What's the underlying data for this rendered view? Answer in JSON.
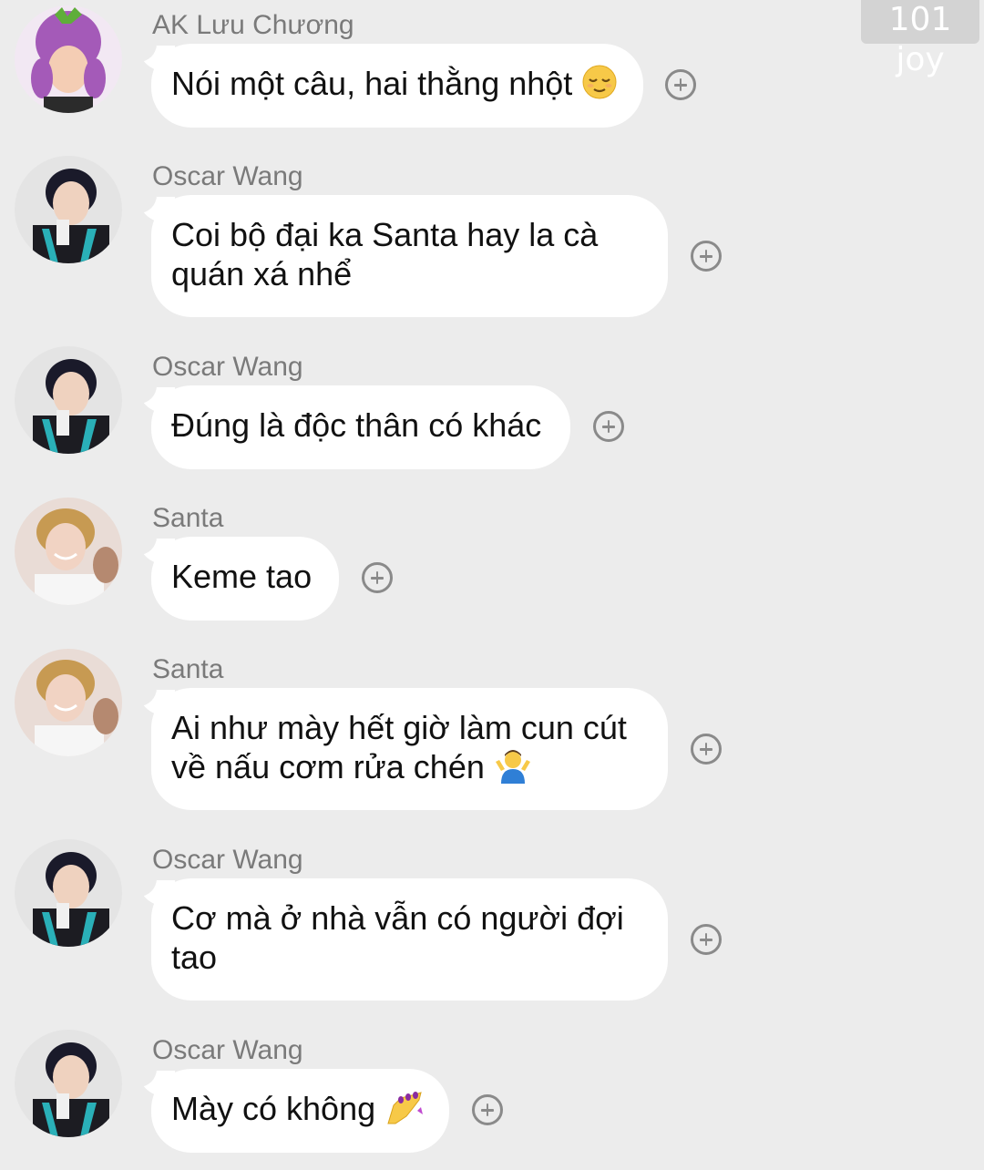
{
  "watermark": "101 joy",
  "messages": [
    {
      "sender": "AK Lưu Chương",
      "lines": [
        "Nói một câu, hai thằng nhột"
      ],
      "emoji": "relieved-face-emoji"
    },
    {
      "sender": "Oscar Wang",
      "lines": [
        "Coi bộ đại ka Santa hay la cà",
        "quán xá nhể"
      ],
      "emoji": null
    },
    {
      "sender": "Oscar Wang",
      "lines": [
        "Đúng là độc thân có khác"
      ],
      "emoji": null
    },
    {
      "sender": "Santa",
      "lines": [
        "Keme tao"
      ],
      "emoji": null
    },
    {
      "sender": "Santa",
      "lines": [
        "Ai như mày hết giờ làm cun cút",
        "về nấu cơm rửa chén"
      ],
      "emoji": "person-shrugging-emoji"
    },
    {
      "sender": "Oscar Wang",
      "lines": [
        "Cơ mà ở nhà vẫn có người đợi",
        "tao"
      ],
      "emoji": null
    },
    {
      "sender": "Oscar Wang",
      "lines": [
        "Mày có không"
      ],
      "emoji": "nail-polish-emoji"
    }
  ],
  "colors": {
    "background": "#ececec",
    "bubble": "#ffffff",
    "sender_text": "#7a7a7a",
    "message_text": "#111111",
    "icon": "#8a8a8a"
  }
}
